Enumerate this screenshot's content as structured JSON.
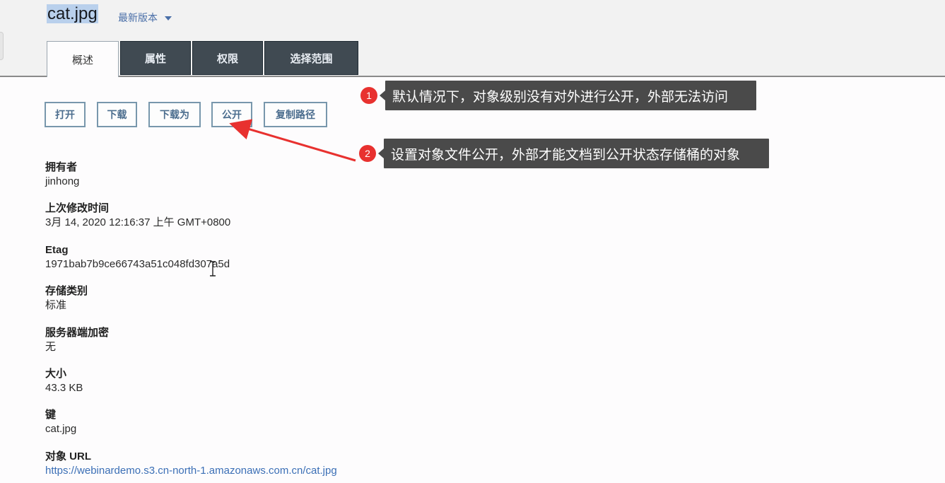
{
  "header": {
    "filename": "cat.jpg",
    "version_label": "最新版本"
  },
  "tabs": [
    {
      "label": "概述",
      "active": true
    },
    {
      "label": "属性",
      "active": false
    },
    {
      "label": "权限",
      "active": false
    },
    {
      "label": "选择范围",
      "active": false
    }
  ],
  "actions": {
    "open": "打开",
    "download": "下载",
    "download_as": "下载为",
    "make_public": "公开",
    "copy_path": "复制路径"
  },
  "properties": {
    "owner": {
      "label": "拥有者",
      "value": "jinhong"
    },
    "last_modified": {
      "label": "上次修改时间",
      "value": "3月 14, 2020 12:16:37 上午 GMT+0800"
    },
    "etag": {
      "label": "Etag",
      "value": "1971bab7b9ce66743a51c048fd307a5d"
    },
    "storage_class": {
      "label": "存储类别",
      "value": "标准"
    },
    "encryption": {
      "label": "服务器端加密",
      "value": "无"
    },
    "size": {
      "label": "大小",
      "value": "43.3 KB"
    },
    "key": {
      "label": "键",
      "value": "cat.jpg"
    },
    "object_url": {
      "label": "对象 URL",
      "value": "https://webinardemo.s3.cn-north-1.amazonaws.com.cn/cat.jpg"
    }
  },
  "annotations": [
    {
      "number": "1",
      "text": "默认情况下，对象级别没有对外进行公开，外部无法访问"
    },
    {
      "number": "2",
      "text": "设置对象文件公开，外部才能文档到公开状态存储桶的对象"
    }
  ],
  "colors": {
    "tab_dark": "#404a52",
    "button_border": "#7897ac",
    "link": "#3b6fb6",
    "badge": "#e8312f",
    "callout": "#4a4a4a",
    "arrow": "#e8312f"
  }
}
